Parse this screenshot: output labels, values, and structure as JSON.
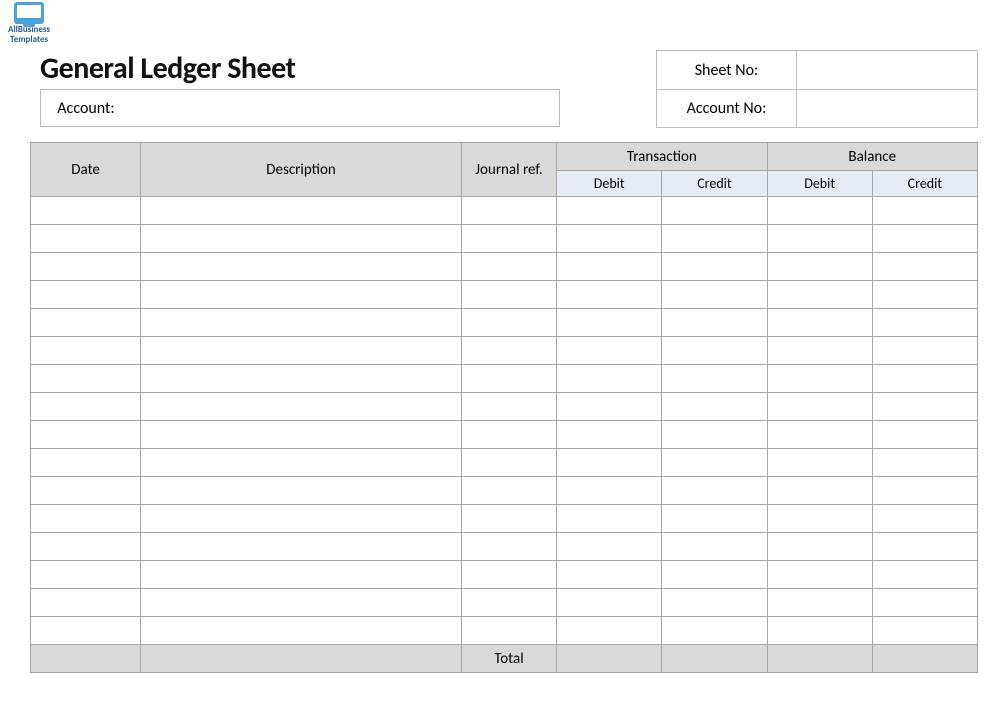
{
  "brand": {
    "line1": "AllBusiness",
    "line2": "Templates"
  },
  "title": "General Ledger Sheet",
  "fields": {
    "sheet_no_label": "Sheet No:",
    "sheet_no_value": "",
    "account_no_label": "Account No:",
    "account_no_value": "",
    "account_label": "Account:",
    "account_value": ""
  },
  "columns": {
    "date": "Date",
    "description": "Description",
    "journal_ref": "Journal ref.",
    "transaction": "Transaction",
    "balance": "Balance",
    "debit": "Debit",
    "credit": "Credit"
  },
  "rows": [
    {
      "date": "",
      "description": "",
      "journal_ref": "",
      "t_debit": "",
      "t_credit": "",
      "b_debit": "",
      "b_credit": ""
    },
    {
      "date": "",
      "description": "",
      "journal_ref": "",
      "t_debit": "",
      "t_credit": "",
      "b_debit": "",
      "b_credit": ""
    },
    {
      "date": "",
      "description": "",
      "journal_ref": "",
      "t_debit": "",
      "t_credit": "",
      "b_debit": "",
      "b_credit": ""
    },
    {
      "date": "",
      "description": "",
      "journal_ref": "",
      "t_debit": "",
      "t_credit": "",
      "b_debit": "",
      "b_credit": ""
    },
    {
      "date": "",
      "description": "",
      "journal_ref": "",
      "t_debit": "",
      "t_credit": "",
      "b_debit": "",
      "b_credit": ""
    },
    {
      "date": "",
      "description": "",
      "journal_ref": "",
      "t_debit": "",
      "t_credit": "",
      "b_debit": "",
      "b_credit": ""
    },
    {
      "date": "",
      "description": "",
      "journal_ref": "",
      "t_debit": "",
      "t_credit": "",
      "b_debit": "",
      "b_credit": ""
    },
    {
      "date": "",
      "description": "",
      "journal_ref": "",
      "t_debit": "",
      "t_credit": "",
      "b_debit": "",
      "b_credit": ""
    },
    {
      "date": "",
      "description": "",
      "journal_ref": "",
      "t_debit": "",
      "t_credit": "",
      "b_debit": "",
      "b_credit": ""
    },
    {
      "date": "",
      "description": "",
      "journal_ref": "",
      "t_debit": "",
      "t_credit": "",
      "b_debit": "",
      "b_credit": ""
    },
    {
      "date": "",
      "description": "",
      "journal_ref": "",
      "t_debit": "",
      "t_credit": "",
      "b_debit": "",
      "b_credit": ""
    },
    {
      "date": "",
      "description": "",
      "journal_ref": "",
      "t_debit": "",
      "t_credit": "",
      "b_debit": "",
      "b_credit": ""
    },
    {
      "date": "",
      "description": "",
      "journal_ref": "",
      "t_debit": "",
      "t_credit": "",
      "b_debit": "",
      "b_credit": ""
    },
    {
      "date": "",
      "description": "",
      "journal_ref": "",
      "t_debit": "",
      "t_credit": "",
      "b_debit": "",
      "b_credit": ""
    },
    {
      "date": "",
      "description": "",
      "journal_ref": "",
      "t_debit": "",
      "t_credit": "",
      "b_debit": "",
      "b_credit": ""
    },
    {
      "date": "",
      "description": "",
      "journal_ref": "",
      "t_debit": "",
      "t_credit": "",
      "b_debit": "",
      "b_credit": ""
    }
  ],
  "total_label": "Total",
  "totals": {
    "t_debit": "",
    "t_credit": "",
    "b_debit": "",
    "b_credit": ""
  }
}
